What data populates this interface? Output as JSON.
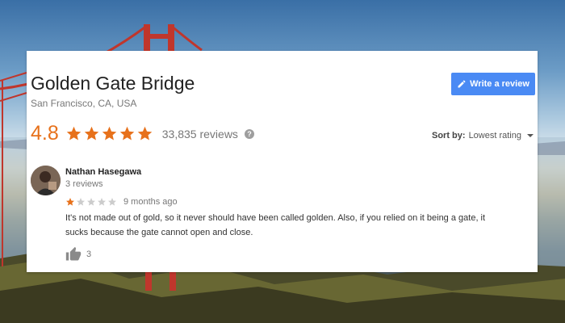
{
  "place": {
    "name": "Golden Gate Bridge",
    "location": "San Francisco, CA, USA"
  },
  "actions": {
    "write_review_label": "Write a review",
    "write_review_icon": "pencil-icon"
  },
  "summary": {
    "rating": "4.8",
    "stars": 5,
    "review_count": "33,835 reviews",
    "help_icon": "help-icon",
    "help_glyph": "?"
  },
  "sort": {
    "label": "Sort by:",
    "value": "Lowest rating"
  },
  "review": {
    "reviewer_name": "Nathan Hasegawa",
    "reviewer_reviews": "3 reviews",
    "stars": 1,
    "time_ago": "9 months ago",
    "text": "It's not made out of gold, so it never should have been called golden. Also, if you relied on it being a gate, it sucks because the gate cannot open and close.",
    "like_count": "3"
  },
  "colors": {
    "star": "#e7711b",
    "star_empty": "#cccccc",
    "button": "#4a8af4",
    "bridge": "#c0362c"
  }
}
